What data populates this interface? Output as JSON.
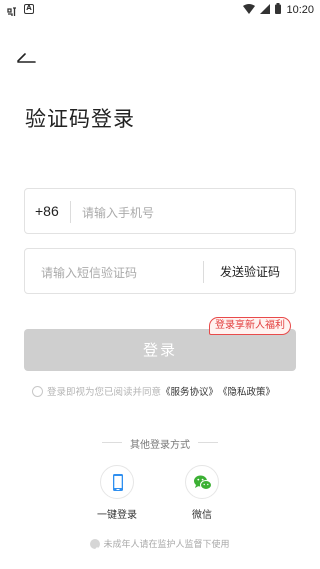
{
  "status_bar": {
    "time": "10:20",
    "app_icon_2_letter": "A"
  },
  "page": {
    "title": "验证码登录"
  },
  "phone": {
    "country_code": "+86",
    "placeholder": "请输入手机号"
  },
  "sms": {
    "placeholder": "请输入短信验证码",
    "send_label": "发送验证码"
  },
  "login": {
    "button_label": "登录",
    "promo_badge": "登录享新人福利"
  },
  "agreement": {
    "prefix": "登录即视为您已阅读并同意",
    "service_link": "《服务协议》",
    "privacy_link": "《隐私政策》"
  },
  "other_login": {
    "title": "其他登录方式",
    "methods": [
      {
        "label": "一键登录",
        "icon": "mobile-phone-icon",
        "color": "#2f8ff0"
      },
      {
        "label": "微信",
        "icon": "wechat-icon",
        "color": "#3cb034"
      }
    ]
  },
  "minor_notice": {
    "text": "未成年人请在监护人监督下使用"
  }
}
